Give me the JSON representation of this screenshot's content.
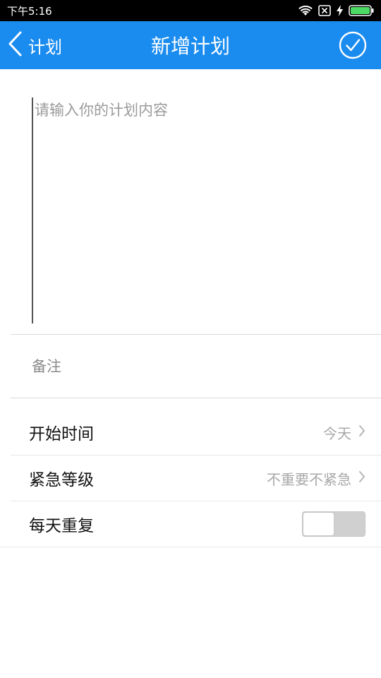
{
  "status_bar": {
    "time": "下午5:16",
    "icons": [
      "wifi-icon",
      "no-sim-icon",
      "charging-icon",
      "battery-icon"
    ]
  },
  "nav": {
    "back_label": "计划",
    "title": "新增计划",
    "confirm_icon": "check-circle-icon"
  },
  "content": {
    "value": "",
    "placeholder": "请输入你的计划内容"
  },
  "note": {
    "value": "",
    "placeholder": "备注"
  },
  "settings": {
    "start_time": {
      "label": "开始时间",
      "value": "今天"
    },
    "urgency": {
      "label": "紧急等级",
      "value": "不重要不紧急"
    },
    "repeat_daily": {
      "label": "每天重复",
      "enabled": false
    }
  },
  "colors": {
    "accent": "#1a8cf0",
    "status_bar": "#000000",
    "divider": "#d9d9d9",
    "muted_text": "#a8a8a8"
  }
}
